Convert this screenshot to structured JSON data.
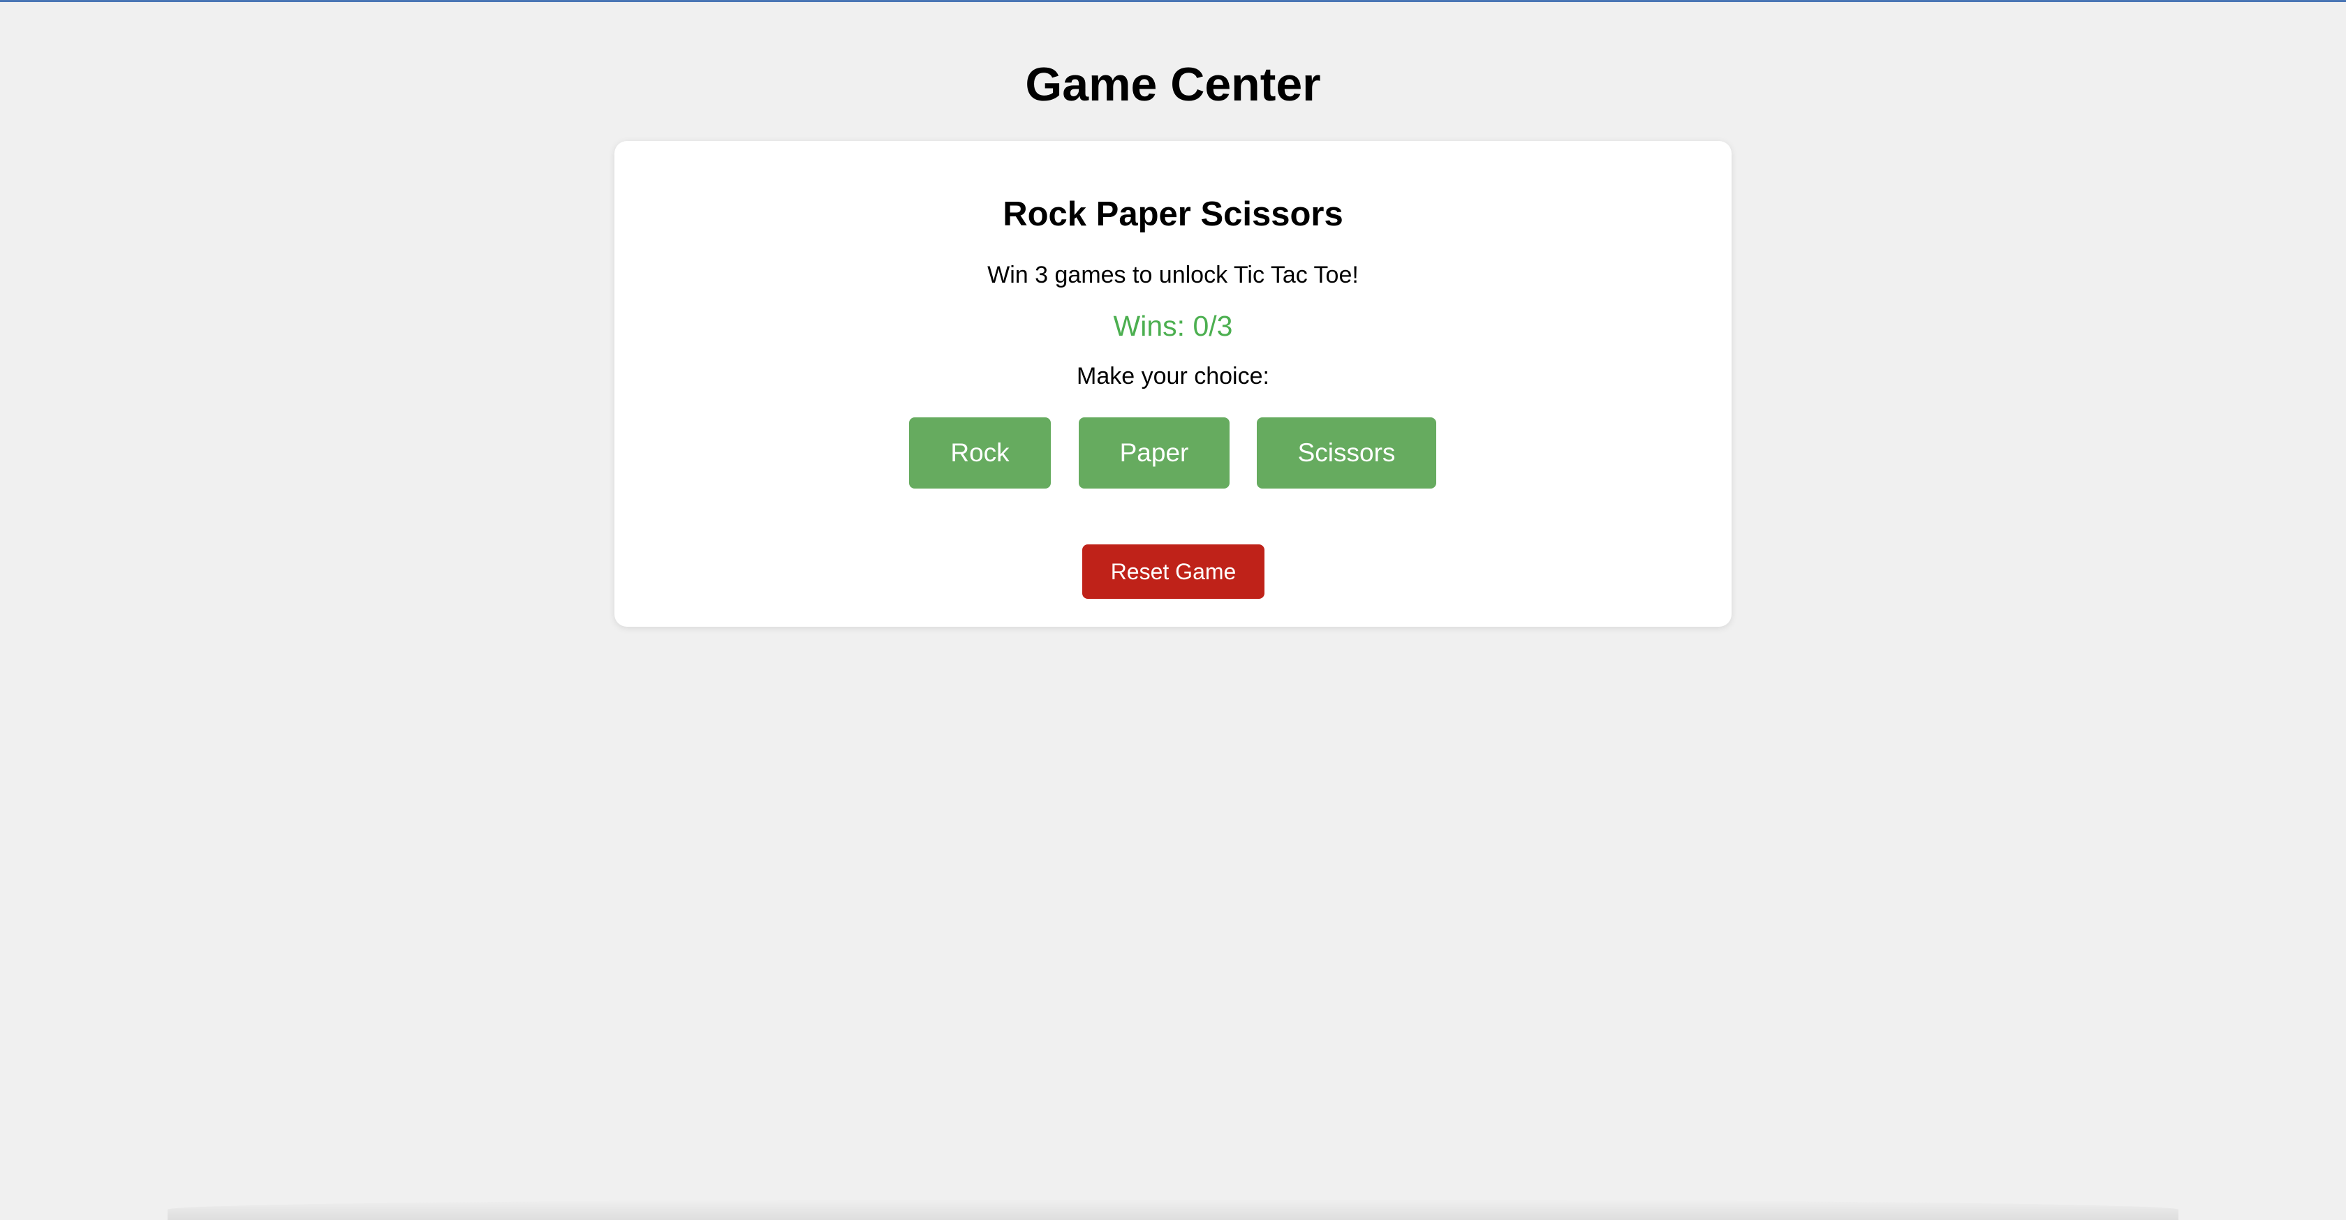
{
  "page": {
    "title": "Game Center"
  },
  "game": {
    "title": "Rock Paper Scissors",
    "subtitle": "Win 3 games to unlock Tic Tac Toe!",
    "wins_text": "Wins: 0/3",
    "wins": 0,
    "wins_target": 3,
    "prompt": "Make your choice:",
    "choices": {
      "rock": "Rock",
      "paper": "Paper",
      "scissors": "Scissors"
    },
    "reset_label": "Reset Game"
  },
  "colors": {
    "background": "#f0f0f0",
    "card": "#ffffff",
    "choice_button": "#66ab5f",
    "wins_text": "#4caf50",
    "reset_button": "#bf2219",
    "top_rule": "#4a76b5"
  }
}
